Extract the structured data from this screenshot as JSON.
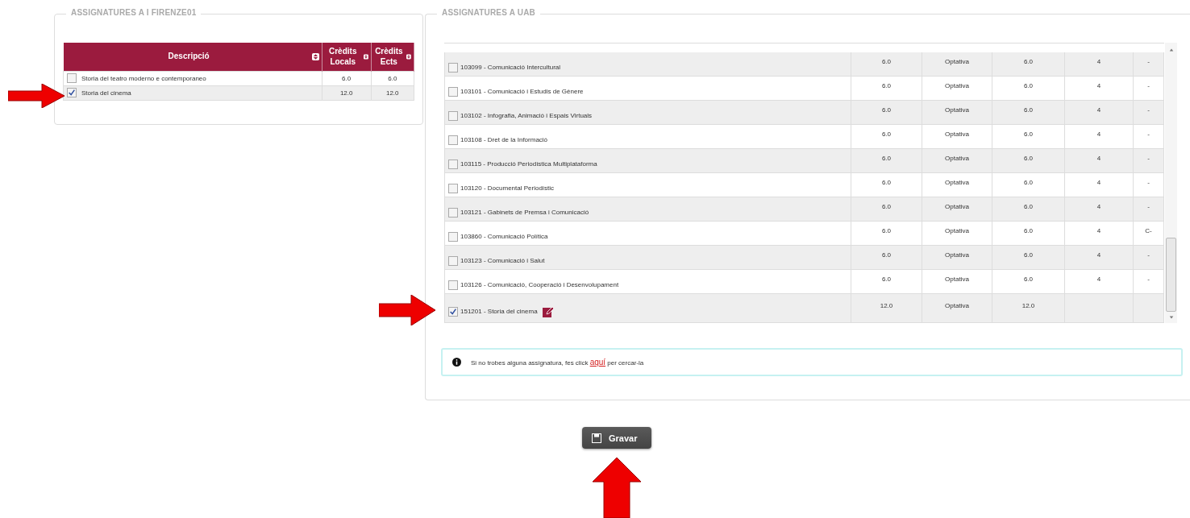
{
  "local_panel": {
    "legend": "ASSIGNATURES A I FIRENZE01",
    "columns": [
      {
        "label": "Descripció"
      },
      {
        "label": "Crèdits Locals"
      },
      {
        "label": "Crèdits Ects"
      }
    ],
    "rows": [
      {
        "checked": false,
        "description": "Storia del teatro moderno e contemporaneo",
        "local_credits": "6.0",
        "ects_credits": "6.0"
      },
      {
        "checked": true,
        "description": "Storia del cinema",
        "local_credits": "12.0",
        "ects_credits": "12.0"
      }
    ]
  },
  "uab_panel": {
    "legend": "ASSIGNATURES A UAB",
    "rows": [
      {
        "checked": false,
        "subject": "103099 - Comunicació Intercultural",
        "credits": "6.0",
        "type": "Optativa",
        "ects": "6.0",
        "column_5": "4",
        "column_6": "-",
        "editable": false
      },
      {
        "checked": false,
        "subject": "103101 - Comunicació i Estudis de Gènere",
        "credits": "6.0",
        "type": "Optativa",
        "ects": "6.0",
        "column_5": "4",
        "column_6": "-",
        "editable": false
      },
      {
        "checked": false,
        "subject": "103102 - Infografia, Animació i Espais Virtuals",
        "credits": "6.0",
        "type": "Optativa",
        "ects": "6.0",
        "column_5": "4",
        "column_6": "-",
        "editable": false
      },
      {
        "checked": false,
        "subject": "103108 - Dret de la Informació",
        "credits": "6.0",
        "type": "Optativa",
        "ects": "6.0",
        "column_5": "4",
        "column_6": "-",
        "editable": false
      },
      {
        "checked": false,
        "subject": "103115 - Producció Periodística Multiplataforma",
        "credits": "6.0",
        "type": "Optativa",
        "ects": "6.0",
        "column_5": "4",
        "column_6": "-",
        "editable": false
      },
      {
        "checked": false,
        "subject": "103120 - Documental Periodístic",
        "credits": "6.0",
        "type": "Optativa",
        "ects": "6.0",
        "column_5": "4",
        "column_6": "-",
        "editable": false
      },
      {
        "checked": false,
        "subject": "103121 - Gabinets de Premsa i Comunicació",
        "credits": "6.0",
        "type": "Optativa",
        "ects": "6.0",
        "column_5": "4",
        "column_6": "-",
        "editable": false
      },
      {
        "checked": false,
        "subject": "103860 - Comunicació Política",
        "credits": "6.0",
        "type": "Optativa",
        "ects": "6.0",
        "column_5": "4",
        "column_6": "C-",
        "editable": false
      },
      {
        "checked": false,
        "subject": "103123 - Comunicació i Salut",
        "credits": "6.0",
        "type": "Optativa",
        "ects": "6.0",
        "column_5": "4",
        "column_6": "-",
        "editable": false
      },
      {
        "checked": false,
        "subject": "103126 - Comunicació, Cooperació i Desenvolupament",
        "credits": "6.0",
        "type": "Optativa",
        "ects": "6.0",
        "column_5": "4",
        "column_6": "-",
        "editable": false
      },
      {
        "checked": true,
        "subject": "151201 - Storia del cinema",
        "credits": "12.0",
        "type": "Optativa",
        "ects": "12.0",
        "editable": true
      }
    ],
    "info": {
      "before": "Si no trobes alguna assignatura, fes click",
      "link": "aquí",
      "after": "per cercar-la"
    }
  },
  "save_button": {
    "label": "Gravar"
  }
}
